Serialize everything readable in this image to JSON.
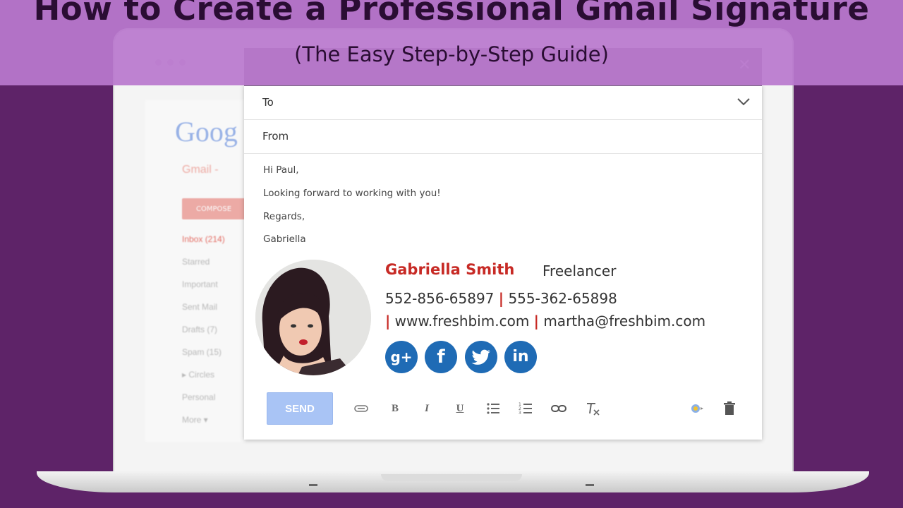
{
  "header": {
    "title": "How to Create a Professional Gmail Signature",
    "subtitle": "(The Easy Step-by-Step Guide)"
  },
  "gmail_bg": {
    "logo": "Goog",
    "label": "Gmail -",
    "compose_label": "COMPOSE",
    "nav": [
      "Inbox (214)",
      "Starred",
      "Important",
      "Sent Mail",
      "Drafts (7)",
      "Spam (15)",
      "▸ Circles",
      "Personal",
      "More ▾"
    ]
  },
  "compose": {
    "close_icon": "close-icon",
    "to_label": "To",
    "from_label": "From",
    "body_lines": [
      "Hi Paul,",
      "Looking forward to working with you!",
      "Regards,",
      "Gabriella"
    ],
    "send_label": "SEND"
  },
  "signature": {
    "name": "Gabriella Smith",
    "role": "Freelancer",
    "phone1": "552-856-65897",
    "phone2": "555-362-65898",
    "website": "www.freshbim.com",
    "email": "martha@freshbim.com",
    "separator": "|",
    "social": [
      {
        "icon": "google-plus-icon",
        "glyph": "g+"
      },
      {
        "icon": "facebook-icon",
        "glyph": "f"
      },
      {
        "icon": "twitter-icon",
        "glyph": "t"
      },
      {
        "icon": "linkedin-icon",
        "glyph": "in"
      }
    ]
  },
  "toolbar": {
    "tools": [
      "attach-icon",
      "bold-icon",
      "italic-icon",
      "underline-icon",
      "bulleted-list-icon",
      "numbered-list-icon",
      "link-icon",
      "clear-formatting-icon",
      "insert-photo-icon",
      "trash-icon"
    ],
    "bold_glyph": "B",
    "italic_glyph": "I",
    "underline_glyph": "U"
  },
  "colors": {
    "background": "#5e2368",
    "header_band": "#b978cd",
    "title_text": "#2a0d33",
    "signature_name": "#c72a25",
    "social_blue": "#1f6bb5",
    "send_button": "#a9c4f5"
  }
}
